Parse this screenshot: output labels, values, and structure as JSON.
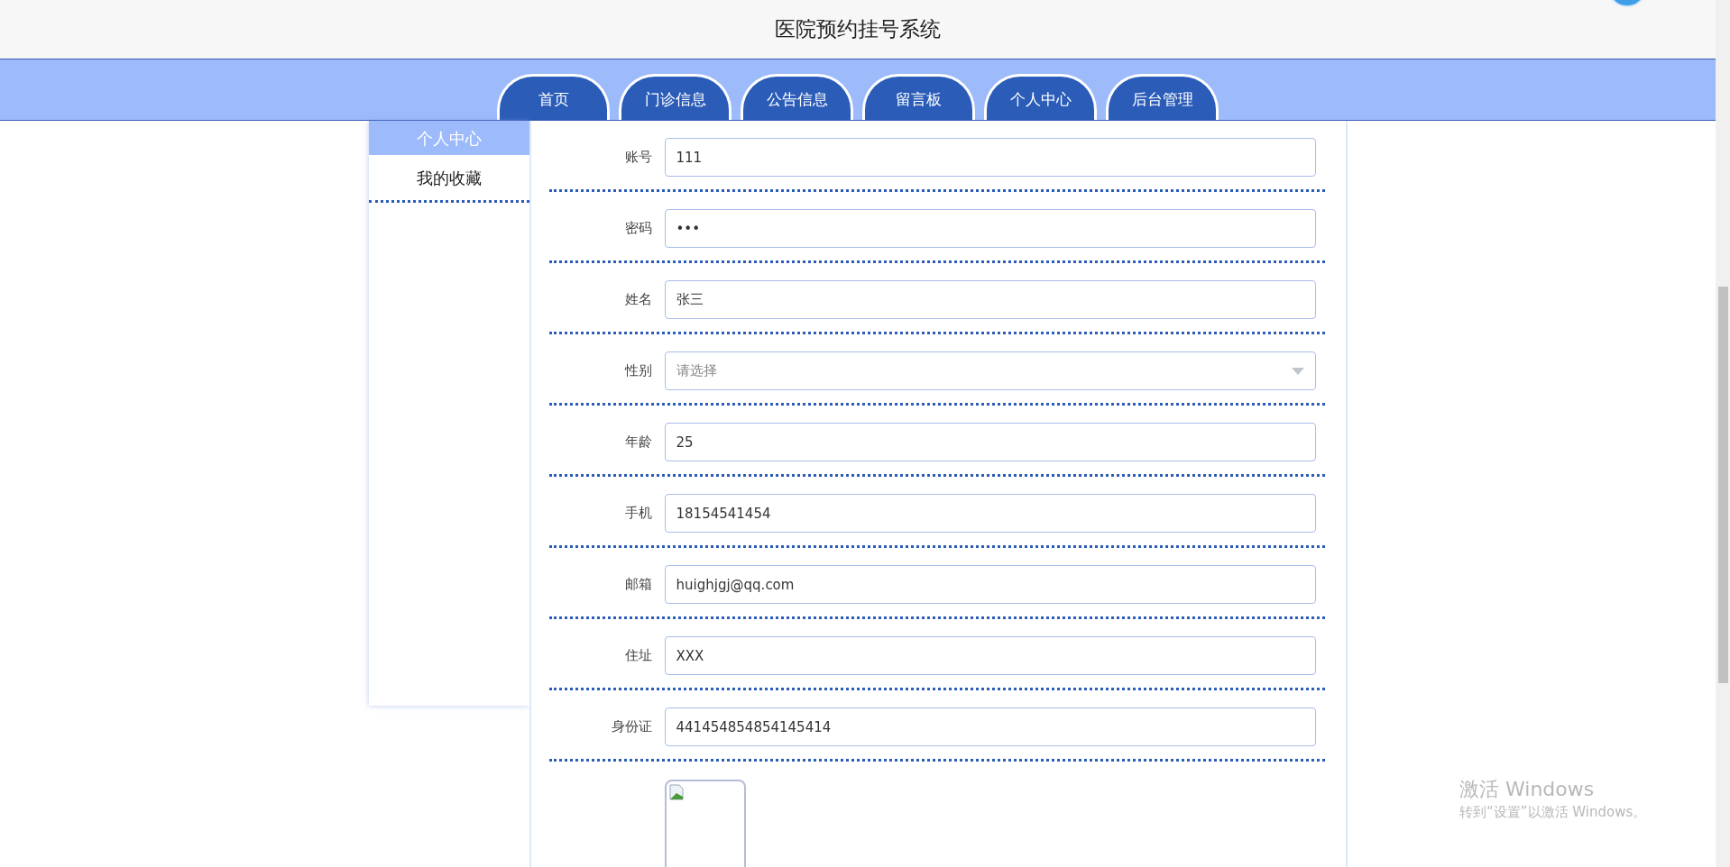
{
  "header": {
    "title": "医院预约挂号系统"
  },
  "nav": {
    "tabs": [
      {
        "label": "首页",
        "selected": false
      },
      {
        "label": "门诊信息",
        "selected": false
      },
      {
        "label": "公告信息",
        "selected": false
      },
      {
        "label": "留言板",
        "selected": false
      },
      {
        "label": "个人中心",
        "selected": false
      },
      {
        "label": "后台管理",
        "selected": false
      }
    ]
  },
  "sidebar": {
    "items": [
      {
        "label": "个人中心",
        "selected": true
      },
      {
        "label": "我的收藏",
        "selected": false
      }
    ]
  },
  "form": {
    "fields": [
      {
        "kind": "input",
        "label": "账号",
        "value": "111"
      },
      {
        "kind": "input",
        "label": "密码",
        "value": "•••"
      },
      {
        "kind": "input",
        "label": "姓名",
        "value": "张三"
      },
      {
        "kind": "select",
        "label": "性别",
        "placeholder": "请选择"
      },
      {
        "kind": "input",
        "label": "年龄",
        "value": "25"
      },
      {
        "kind": "input",
        "label": "手机",
        "value": "18154541454"
      },
      {
        "kind": "input",
        "label": "邮箱",
        "value": "huighjgj@qq.com"
      },
      {
        "kind": "input",
        "label": "住址",
        "value": "XXX"
      },
      {
        "kind": "input",
        "label": "身份证",
        "value": "441454854854145414"
      },
      {
        "kind": "image"
      }
    ]
  },
  "activation_notice": {
    "title": "激活 Windows",
    "subtitle": "转到“设置”以激活 Windows。"
  }
}
